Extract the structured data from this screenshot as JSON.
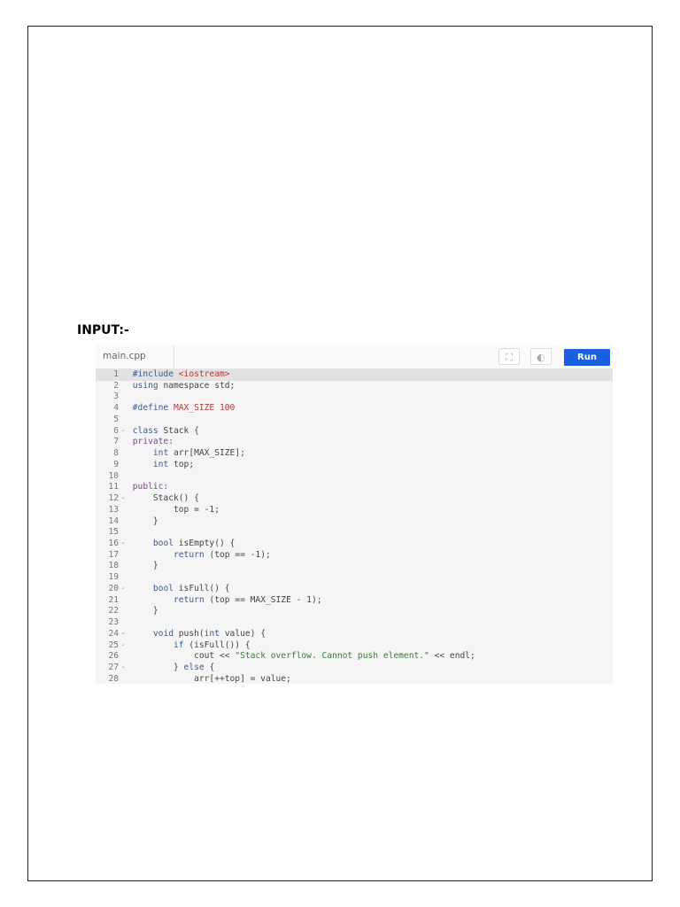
{
  "heading": "INPUT:-",
  "editor": {
    "tab": "main.cpp",
    "fullscreen_icon": "⛶",
    "theme_icon": "◐",
    "run_label": "Run",
    "lines": [
      {
        "n": "1",
        "fold": "",
        "seg": [
          [
            "k",
            "#include "
          ],
          [
            "m",
            "<iostream>"
          ]
        ]
      },
      {
        "n": "2",
        "fold": "",
        "seg": [
          [
            "k",
            "using "
          ],
          [
            "",
            "namespace "
          ],
          [
            "",
            "std;"
          ]
        ]
      },
      {
        "n": "3",
        "fold": "",
        "seg": []
      },
      {
        "n": "4",
        "fold": "",
        "seg": [
          [
            "k",
            "#define "
          ],
          [
            "m",
            "MAX_SIZE 100"
          ]
        ]
      },
      {
        "n": "5",
        "fold": "",
        "seg": []
      },
      {
        "n": "6",
        "fold": "-",
        "seg": [
          [
            "k",
            "class "
          ],
          [
            "",
            "Stack {"
          ]
        ]
      },
      {
        "n": "7",
        "fold": "",
        "seg": [
          [
            "p",
            "private:"
          ]
        ]
      },
      {
        "n": "8",
        "fold": "",
        "seg": [
          [
            "",
            "    "
          ],
          [
            "k",
            "int "
          ],
          [
            "",
            "arr[MAX_SIZE];"
          ]
        ]
      },
      {
        "n": "9",
        "fold": "",
        "seg": [
          [
            "",
            "    "
          ],
          [
            "k",
            "int "
          ],
          [
            "",
            "top;"
          ]
        ]
      },
      {
        "n": "10",
        "fold": "",
        "seg": []
      },
      {
        "n": "11",
        "fold": "",
        "seg": [
          [
            "p",
            "public:"
          ]
        ]
      },
      {
        "n": "12",
        "fold": "-",
        "seg": [
          [
            "",
            "    Stack() {"
          ]
        ]
      },
      {
        "n": "13",
        "fold": "",
        "seg": [
          [
            "",
            "        top = -1;"
          ]
        ]
      },
      {
        "n": "14",
        "fold": "",
        "seg": [
          [
            "",
            "    }"
          ]
        ]
      },
      {
        "n": "15",
        "fold": "",
        "seg": []
      },
      {
        "n": "16",
        "fold": "-",
        "seg": [
          [
            "",
            "    "
          ],
          [
            "k",
            "bool "
          ],
          [
            "",
            "isEmpty() {"
          ]
        ]
      },
      {
        "n": "17",
        "fold": "",
        "seg": [
          [
            "",
            "        "
          ],
          [
            "k",
            "return "
          ],
          [
            "",
            "(top == -1);"
          ]
        ]
      },
      {
        "n": "18",
        "fold": "",
        "seg": [
          [
            "",
            "    }"
          ]
        ]
      },
      {
        "n": "19",
        "fold": "",
        "seg": []
      },
      {
        "n": "20",
        "fold": "-",
        "seg": [
          [
            "",
            "    "
          ],
          [
            "k",
            "bool "
          ],
          [
            "",
            "isFull() {"
          ]
        ]
      },
      {
        "n": "21",
        "fold": "",
        "seg": [
          [
            "",
            "        "
          ],
          [
            "k",
            "return "
          ],
          [
            "",
            "(top == MAX_SIZE - 1);"
          ]
        ]
      },
      {
        "n": "22",
        "fold": "",
        "seg": [
          [
            "",
            "    }"
          ]
        ]
      },
      {
        "n": "23",
        "fold": "",
        "seg": []
      },
      {
        "n": "24",
        "fold": "-",
        "seg": [
          [
            "",
            "    "
          ],
          [
            "k",
            "void "
          ],
          [
            "",
            "push("
          ],
          [
            "k",
            "int "
          ],
          [
            "",
            "value) {"
          ]
        ]
      },
      {
        "n": "25",
        "fold": "-",
        "seg": [
          [
            "",
            "        "
          ],
          [
            "k",
            "if "
          ],
          [
            "",
            "(isFull()) {"
          ]
        ]
      },
      {
        "n": "26",
        "fold": "",
        "seg": [
          [
            "",
            "            cout << "
          ],
          [
            "s",
            "\"Stack overflow. Cannot push element.\""
          ],
          [
            "",
            " << endl;"
          ]
        ]
      },
      {
        "n": "27",
        "fold": "-",
        "seg": [
          [
            "",
            "        } "
          ],
          [
            "k",
            "else "
          ],
          [
            "",
            "{"
          ]
        ]
      },
      {
        "n": "28",
        "fold": "",
        "seg": [
          [
            "",
            "            arr[++top] = value;"
          ]
        ]
      }
    ]
  }
}
